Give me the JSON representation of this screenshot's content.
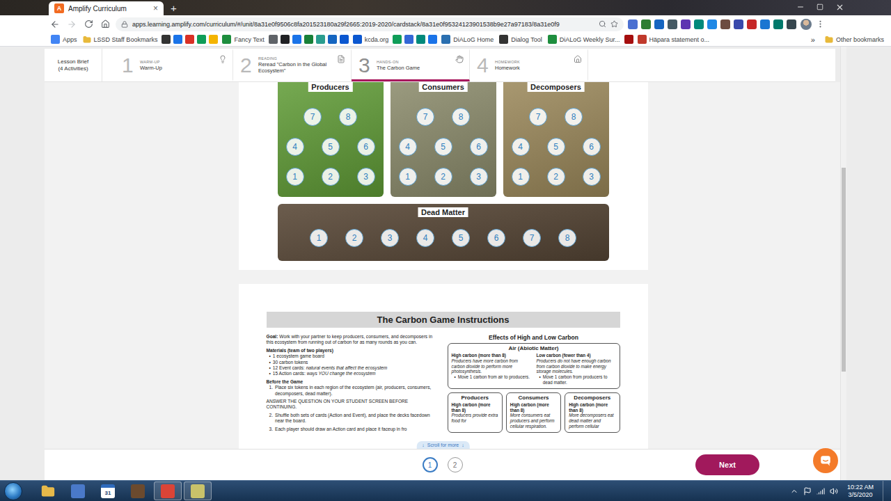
{
  "browser": {
    "tab": {
      "favicon": "A",
      "title": "Amplify Curriculum",
      "close": "×",
      "selected": true
    },
    "new_tab": "+",
    "navigation": {
      "back_enabled": true,
      "forward_enabled": false
    },
    "url": "apps.learning.amplify.com/curriculum/#/unit/8a31e0f9506c8fa201523180a29f2665:2019-2020/cardstack/8a31e0f95324123901538b9e27a97183/8a31e0f9",
    "extensions": [
      "#4a6fd1",
      "#2e7d32",
      "#1565c0",
      "#455a64",
      "#5e35b1",
      "#00897b",
      "#1e88e5",
      "#6d4c41",
      "#3949ab",
      "#c62828",
      "#1976d2",
      "#00796b",
      "#37474f"
    ],
    "bookmarks": [
      {
        "kind": "link",
        "label": "Apps",
        "color": "#4285f4"
      },
      {
        "kind": "folder",
        "label": "LSSD Staff Bookmarks",
        "color": "#e8b93a"
      },
      {
        "kind": "icon",
        "color": "#333333"
      },
      {
        "kind": "icon",
        "color": "#1a73e8"
      },
      {
        "kind": "icon",
        "color": "#d93025"
      },
      {
        "kind": "icon",
        "color": "#0f9d58"
      },
      {
        "kind": "icon",
        "color": "#f4b400"
      },
      {
        "kind": "link",
        "label": "Fancy Text",
        "color": "#1e8e3e"
      },
      {
        "kind": "icon",
        "color": "#5f6368"
      },
      {
        "kind": "icon",
        "color": "#202124"
      },
      {
        "kind": "icon",
        "color": "#1a73e8"
      },
      {
        "kind": "icon",
        "color": "#188038"
      },
      {
        "kind": "icon",
        "color": "#2a9d8f"
      },
      {
        "kind": "icon",
        "color": "#1565c0"
      },
      {
        "kind": "icon",
        "color": "#0b57d0"
      },
      {
        "kind": "link",
        "label": "kcda.org",
        "color": "#0b57d0"
      },
      {
        "kind": "icon",
        "color": "#0f9d58"
      },
      {
        "kind": "icon",
        "color": "#3367d6"
      },
      {
        "kind": "icon",
        "color": "#00897b"
      },
      {
        "kind": "icon",
        "color": "#1a73e8"
      },
      {
        "kind": "link",
        "label": "DiALoG Home",
        "color": "#2a6fb0"
      },
      {
        "kind": "link",
        "label": "Dialog Tool",
        "color": "#333333"
      },
      {
        "kind": "link",
        "label": "DiALoG Weekly Sur...",
        "color": "#1e8e3e"
      },
      {
        "kind": "icon",
        "color": "#a50e0e"
      },
      {
        "kind": "link",
        "label": "Häpara statement o...",
        "color": "#c0392b"
      }
    ],
    "overflow": "»",
    "other_bookmarks": "Other bookmarks"
  },
  "lesson_nav": {
    "brief": {
      "title": "Lesson Brief",
      "subtitle": "(4 Activities)"
    },
    "steps": [
      {
        "number": "1",
        "kind_label": "WARM-UP",
        "title": "Warm-Up",
        "selected": false
      },
      {
        "number": "2",
        "kind_label": "READING",
        "title": "Reread \"Carbon in the Global Ecosystem\"",
        "selected": false
      },
      {
        "number": "3",
        "kind_label": "HANDS-ON",
        "title": "The Carbon Game",
        "selected": true
      },
      {
        "number": "4",
        "kind_label": "HOMEWORK",
        "title": "Homework",
        "selected": false
      }
    ]
  },
  "board": {
    "regions": [
      {
        "label": "Producers",
        "color": "#5f9b35",
        "rows": [
          [
            "7",
            "8"
          ],
          [
            "4",
            "5",
            "6"
          ],
          [
            "1",
            "2",
            "3"
          ]
        ]
      },
      {
        "label": "Consumers",
        "color": "#8a8a6a",
        "rows": [
          [
            "7",
            "8"
          ],
          [
            "4",
            "5",
            "6"
          ],
          [
            "1",
            "2",
            "3"
          ]
        ]
      },
      {
        "label": "Decomposers",
        "color": "#9a8759",
        "rows": [
          [
            "7",
            "8"
          ],
          [
            "4",
            "5",
            "6"
          ],
          [
            "1",
            "2",
            "3"
          ]
        ]
      }
    ],
    "dead_matter": {
      "label": "Dead Matter",
      "color": "#5b4a39",
      "slots": [
        "1",
        "2",
        "3",
        "4",
        "5",
        "6",
        "7",
        "8"
      ]
    }
  },
  "instructions": {
    "title": "The Carbon Game Instructions",
    "goal": {
      "label": "Goal:",
      "text": "Work with your partner to keep producers, consumers, and decomposers in this ecosystem from running out of carbon for as many rounds as you can."
    },
    "bullet": "•",
    "materials": {
      "heading": "Materials (team of two players)",
      "items": [
        {
          "text": "1 ecosystem game board"
        },
        {
          "text": "30 carbon tokens"
        },
        {
          "text": "12 Event cards:",
          "note": "natural events that affect the ecosystem"
        },
        {
          "text": "15 Action cards:",
          "note": "ways YOU change the ecosystem"
        }
      ]
    },
    "before_game": {
      "heading": "Before the Game",
      "steps": [
        {
          "number": "1.",
          "text": "Place six tokens in each region of the ecosystem (air, producers, consumers, decomposers, dead matter)."
        }
      ]
    },
    "notice": "ANSWER THE QUESTION ON YOUR STUDENT SCREEN BEFORE CONTINUING.",
    "more_steps": [
      {
        "number": "2.",
        "text": "Shuffle both sets of cards (Action and Event), and place the decks facedown near the board."
      },
      {
        "number": "3.",
        "text": "Each player should draw an Action card and place it faceup in fro"
      }
    ],
    "effects": {
      "title": "Effects of High and Low Carbon",
      "air": {
        "title": "Air (Abiotic Matter)",
        "cases": [
          {
            "heading": "High carbon (more than 8)",
            "text": "Producers have more carbon from carbon dioxide to perform more photosynthesis.",
            "action": "Move 1 carbon from air to producers."
          },
          {
            "heading": "Low carbon (fewer than 4)",
            "text": "Producers do not have enough carbon from carbon dioxide to make energy storage molecules.",
            "action": "Move 1 carbon from producers to dead matter."
          }
        ]
      },
      "boxes": [
        {
          "title": "Producers",
          "heading": "High carbon (more than 8)",
          "text": "Producers provide extra food for"
        },
        {
          "title": "Consumers",
          "heading": "High carbon (more than 8)",
          "text": "More consumers eat producers and perform cellular respiration."
        },
        {
          "title": "Decomposers",
          "heading": "High carbon (more than 8)",
          "text": "More decomposers eat dead matter and perform cellular"
        }
      ]
    }
  },
  "scroll_hint": {
    "arrow": "↓",
    "text": "Scroll for more"
  },
  "pagination": [
    {
      "label": "1",
      "selected": true
    },
    {
      "label": "2",
      "selected": false
    }
  ],
  "next_button": "Next",
  "scrollbar": {
    "offset": 0.28,
    "visible": 0.47
  },
  "taskbar": {
    "pinned": [
      {
        "kind": "folder",
        "color": "#e6b94a",
        "running": false
      },
      {
        "kind": "icon",
        "color": "#4a79c9",
        "running": false
      },
      {
        "kind": "calendar",
        "label": "31",
        "color": "#2f6bbd",
        "running": false
      },
      {
        "kind": "icon",
        "color": "#6b4a2e",
        "running": false
      },
      {
        "kind": "icon",
        "color": "#db4437",
        "running": true
      },
      {
        "kind": "icon",
        "color": "#c9c26a",
        "running": true
      }
    ],
    "time": "10:22 AM",
    "date": "3/5/2020"
  }
}
